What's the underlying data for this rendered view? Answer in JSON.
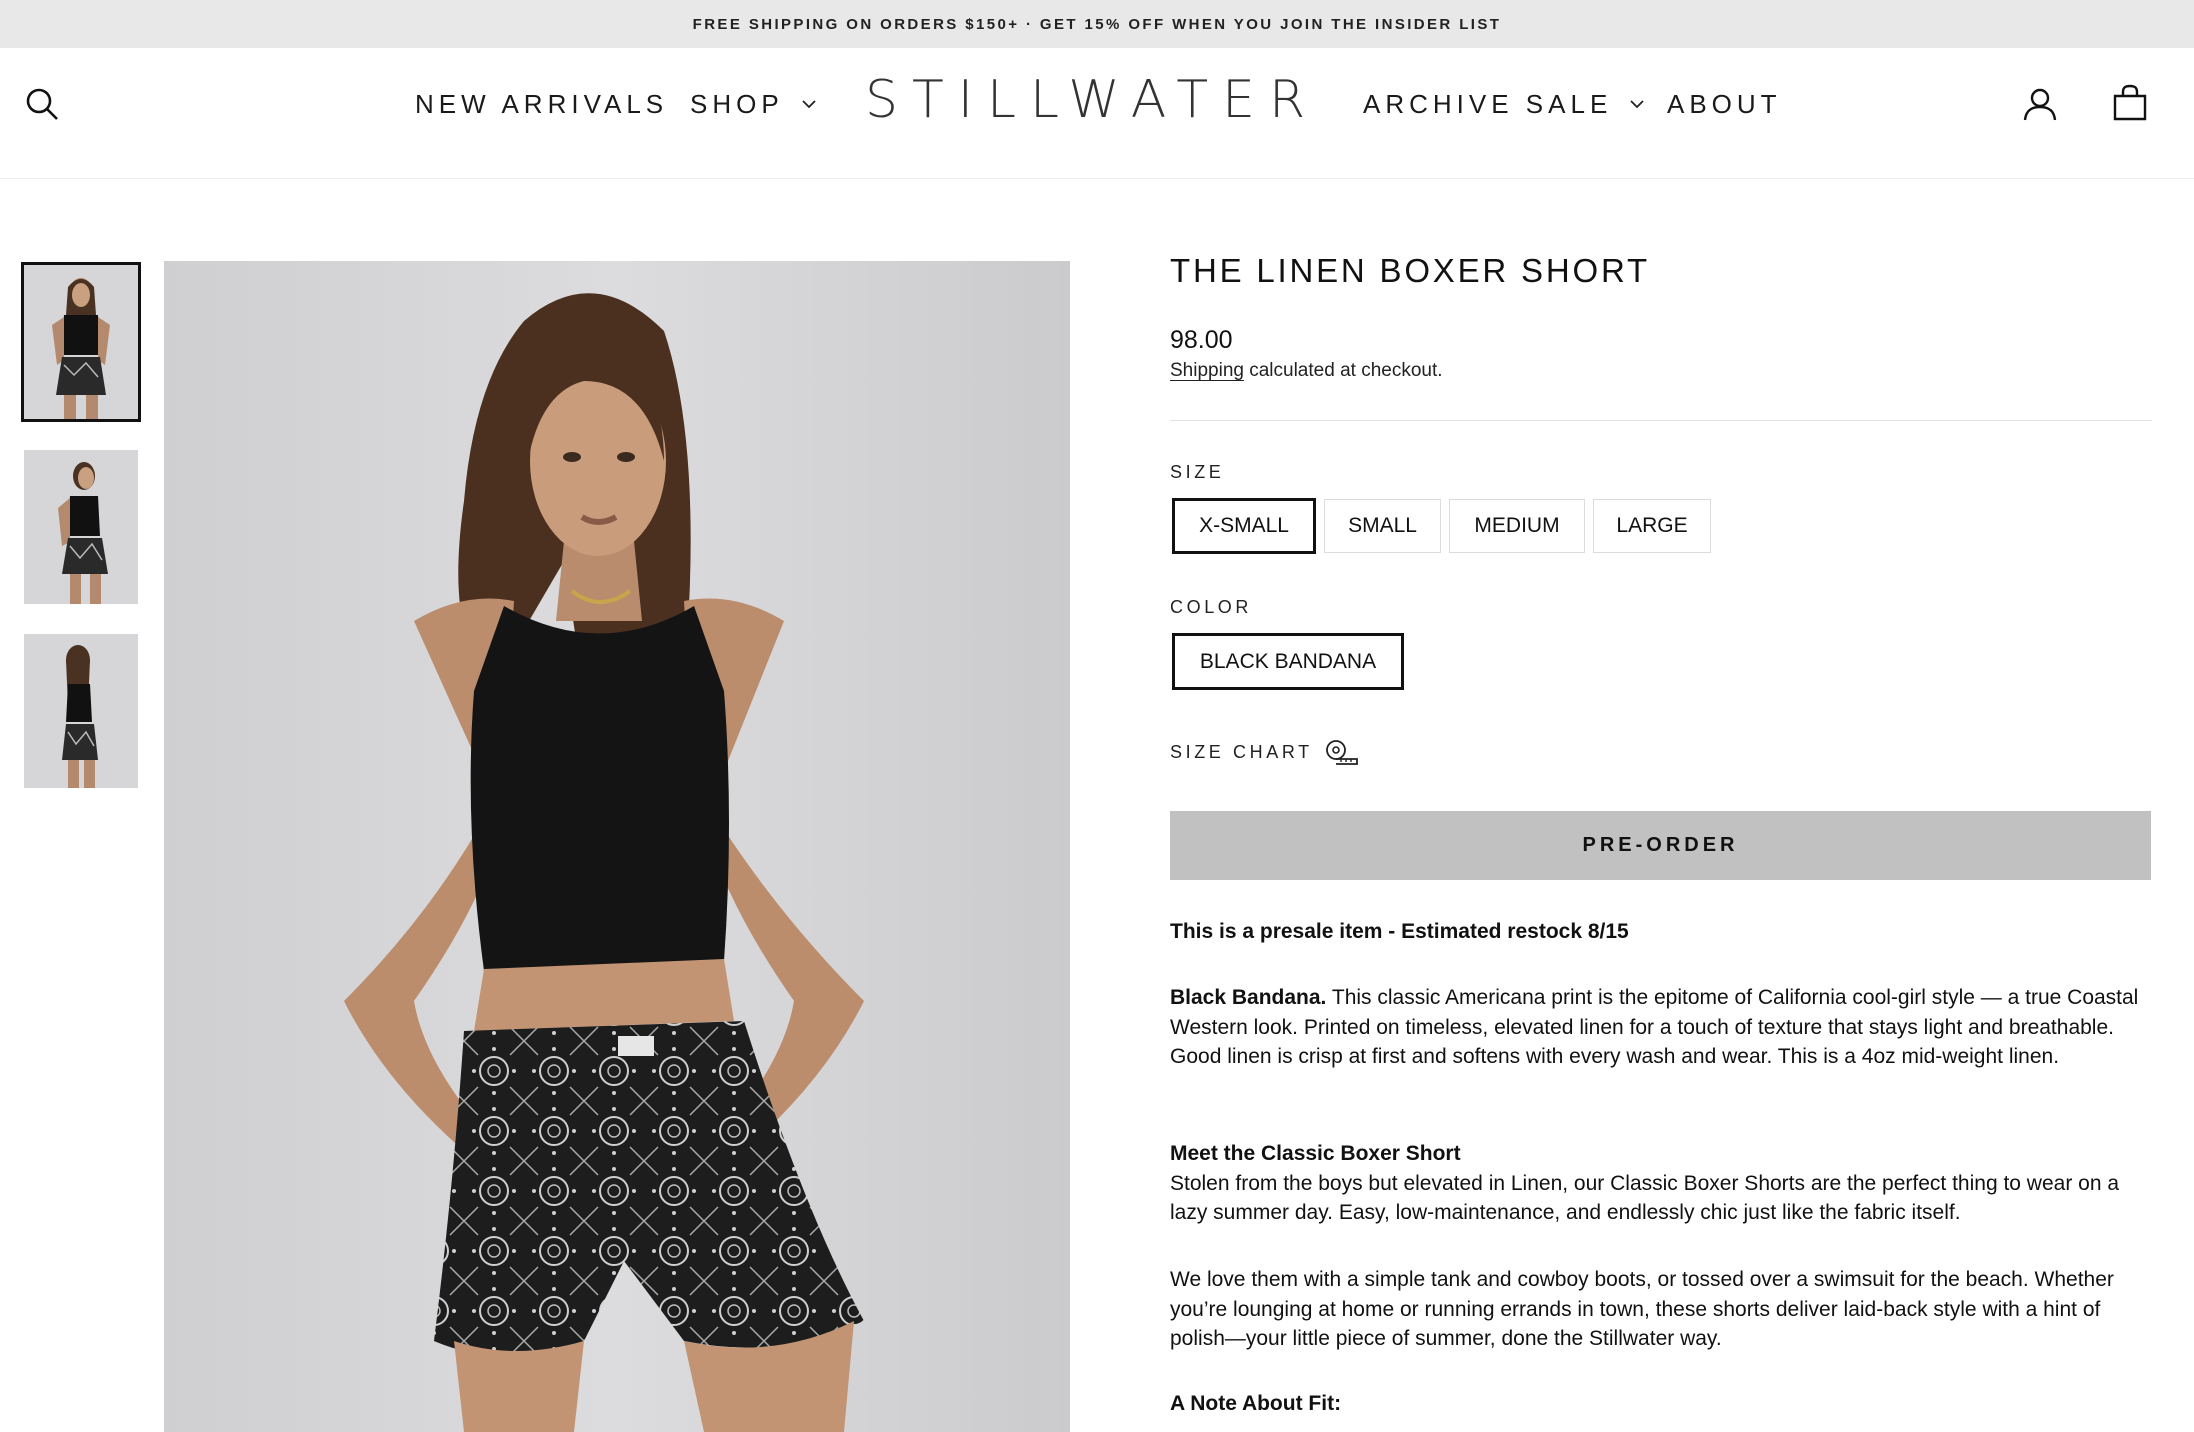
{
  "announcement": "FREE SHIPPING ON ORDERS $150+ · GET 15% OFF WHEN YOU JOIN THE INSIDER LIST",
  "header": {
    "logo": "STILLWATER",
    "nav": {
      "new_arrivals": "NEW ARRIVALS",
      "shop": "SHOP",
      "archive_sale": "ARCHIVE SALE",
      "about": "ABOUT"
    },
    "icons": [
      "search-icon",
      "account-icon",
      "cart-icon"
    ]
  },
  "product": {
    "title": "THE LINEN BOXER SHORT",
    "price": "98.00",
    "shipping_link": "Shipping",
    "shipping_text": " calculated at checkout.",
    "size_label": "SIZE",
    "sizes": [
      "X-SMALL",
      "SMALL",
      "MEDIUM",
      "LARGE"
    ],
    "selected_size": "X-SMALL",
    "color_label": "COLOR",
    "colors": [
      "BLACK BANDANA"
    ],
    "selected_color": "BLACK BANDANA",
    "size_chart": "SIZE CHART",
    "preorder_button": "PRE-ORDER",
    "presale_note": "This is a presale item - Estimated restock 8/15",
    "desc_color_name": "Black Bandana.",
    "desc_color_text": " This classic Americana print is the epitome of California cool-girl style — a true Coastal Western look. Printed on timeless, elevated linen for a touch of texture that stays light and breathable. Good linen is crisp at first and softens with every wash and wear. This is a 4oz mid-weight linen.",
    "desc_meet_heading": "Meet the Classic Boxer Short",
    "desc_meet_text": "Stolen from the boys but elevated in Linen, our Classic Boxer Shorts are the perfect thing to wear on a lazy summer day. Easy, low-maintenance, and endlessly chic just like the fabric itself.",
    "desc_styling": "We love them with a simple tank and cowboy boots, or tossed over a swimsuit for the beach. Whether you’re lounging at home or running errands in town, these shorts deliver laid-back style with a hint of polish—your little piece of summer, done the Stillwater way.",
    "desc_fit_heading": "A Note About Fit:"
  },
  "colors": {
    "announcement_bg": "#e8e8e8",
    "button_bg": "#c1c1c1",
    "text": "#111111",
    "photo_bg": "#d4d4d6"
  }
}
